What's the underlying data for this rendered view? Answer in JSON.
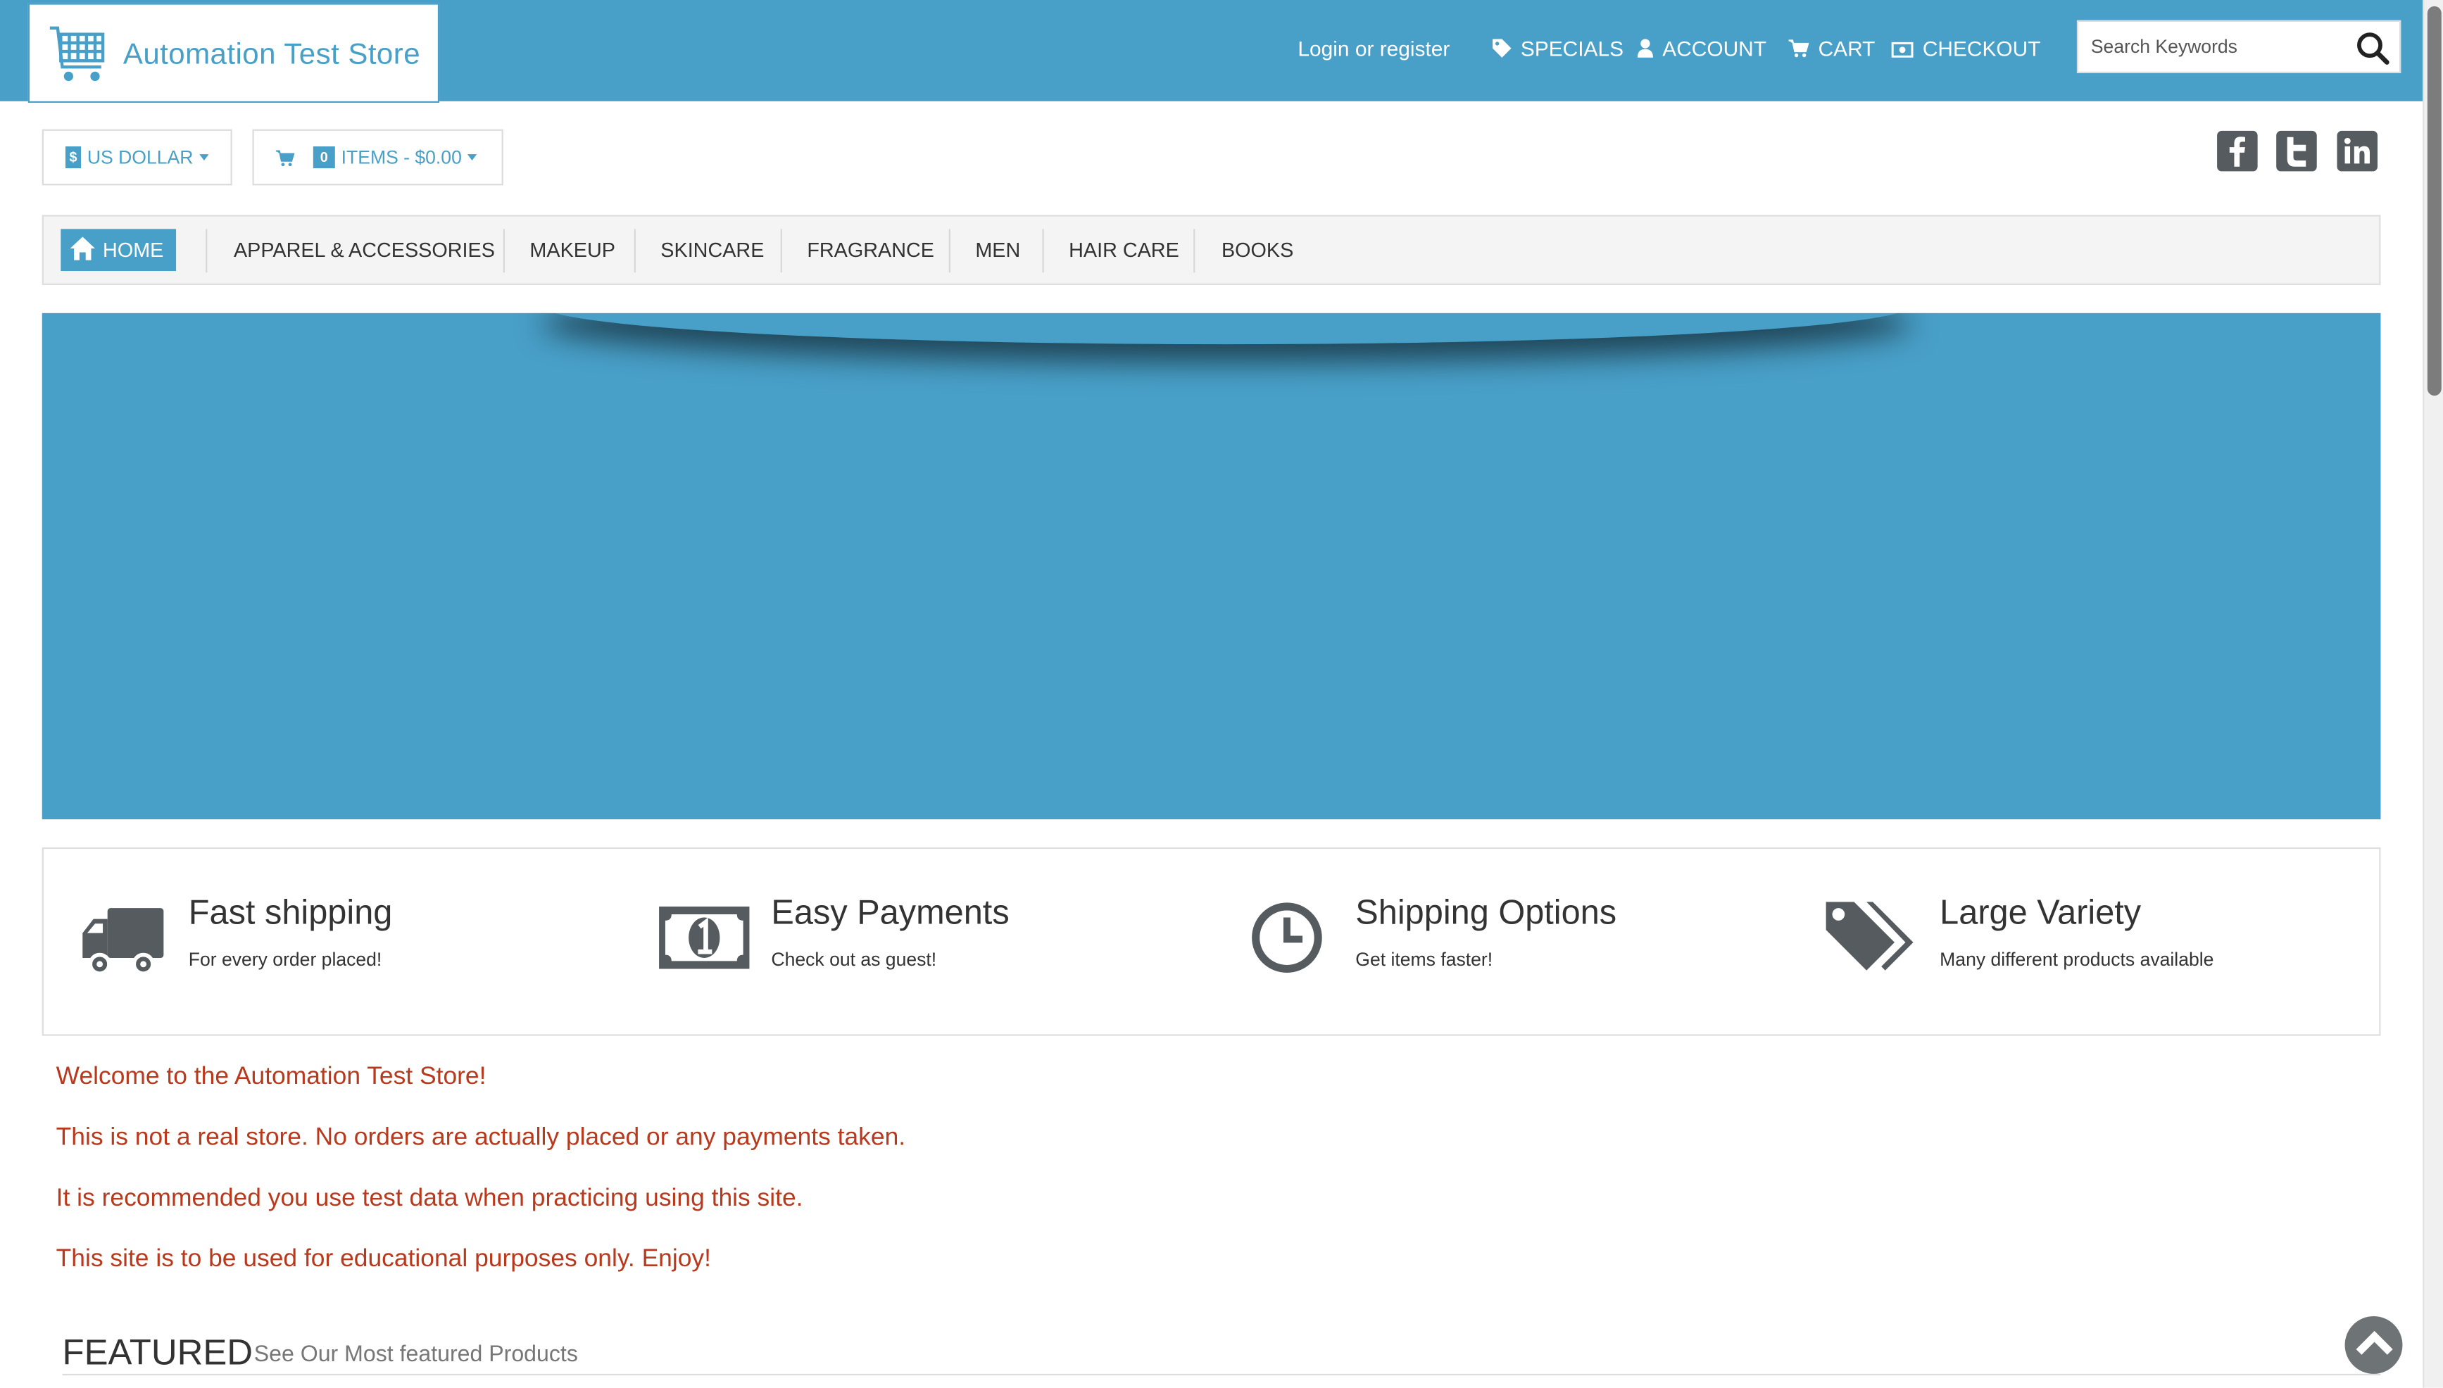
{
  "header": {
    "store_name": "Automation Test Store",
    "login_label": "Login or register",
    "links": {
      "specials": "SPECIALS",
      "account": "ACCOUNT",
      "cart": "CART",
      "checkout": "CHECKOUT"
    },
    "search": {
      "placeholder": "Search Keywords",
      "value": ""
    }
  },
  "toolbar": {
    "currency_symbol": "$",
    "currency_label": "US DOLLAR",
    "cart_count": "0",
    "cart_summary": "ITEMS - $0.00"
  },
  "social": [
    "facebook-icon",
    "twitter-icon",
    "linkedin-icon"
  ],
  "nav": {
    "home": "HOME",
    "items": [
      "APPAREL & ACCESSORIES",
      "MAKEUP",
      "SKINCARE",
      "FRAGRANCE",
      "MEN",
      "HAIR CARE",
      "BOOKS"
    ]
  },
  "features": [
    {
      "icon": "truck-icon",
      "title": "Fast shipping",
      "subtitle": "For every order placed!"
    },
    {
      "icon": "banknote-icon",
      "title": "Easy Payments",
      "subtitle": "Check out as guest!"
    },
    {
      "icon": "clock-icon",
      "title": "Shipping Options",
      "subtitle": "Get items faster!"
    },
    {
      "icon": "tags-icon",
      "title": "Large Variety",
      "subtitle": "Many different products available"
    }
  ],
  "welcome": [
    "Welcome to the Automation Test Store!",
    "This is not a real store. No orders are actually placed or any payments taken.",
    "It is recommended you use test data when practicing using this site.",
    "This site is to be used for educational purposes only. Enjoy!"
  ],
  "featured": {
    "title": "FEATURED",
    "subtitle": "See Our Most featured Products"
  },
  "colors": {
    "brand_blue": "#489fc8",
    "welcome_red": "#b9391c",
    "icon_gray": "#555b5e"
  }
}
